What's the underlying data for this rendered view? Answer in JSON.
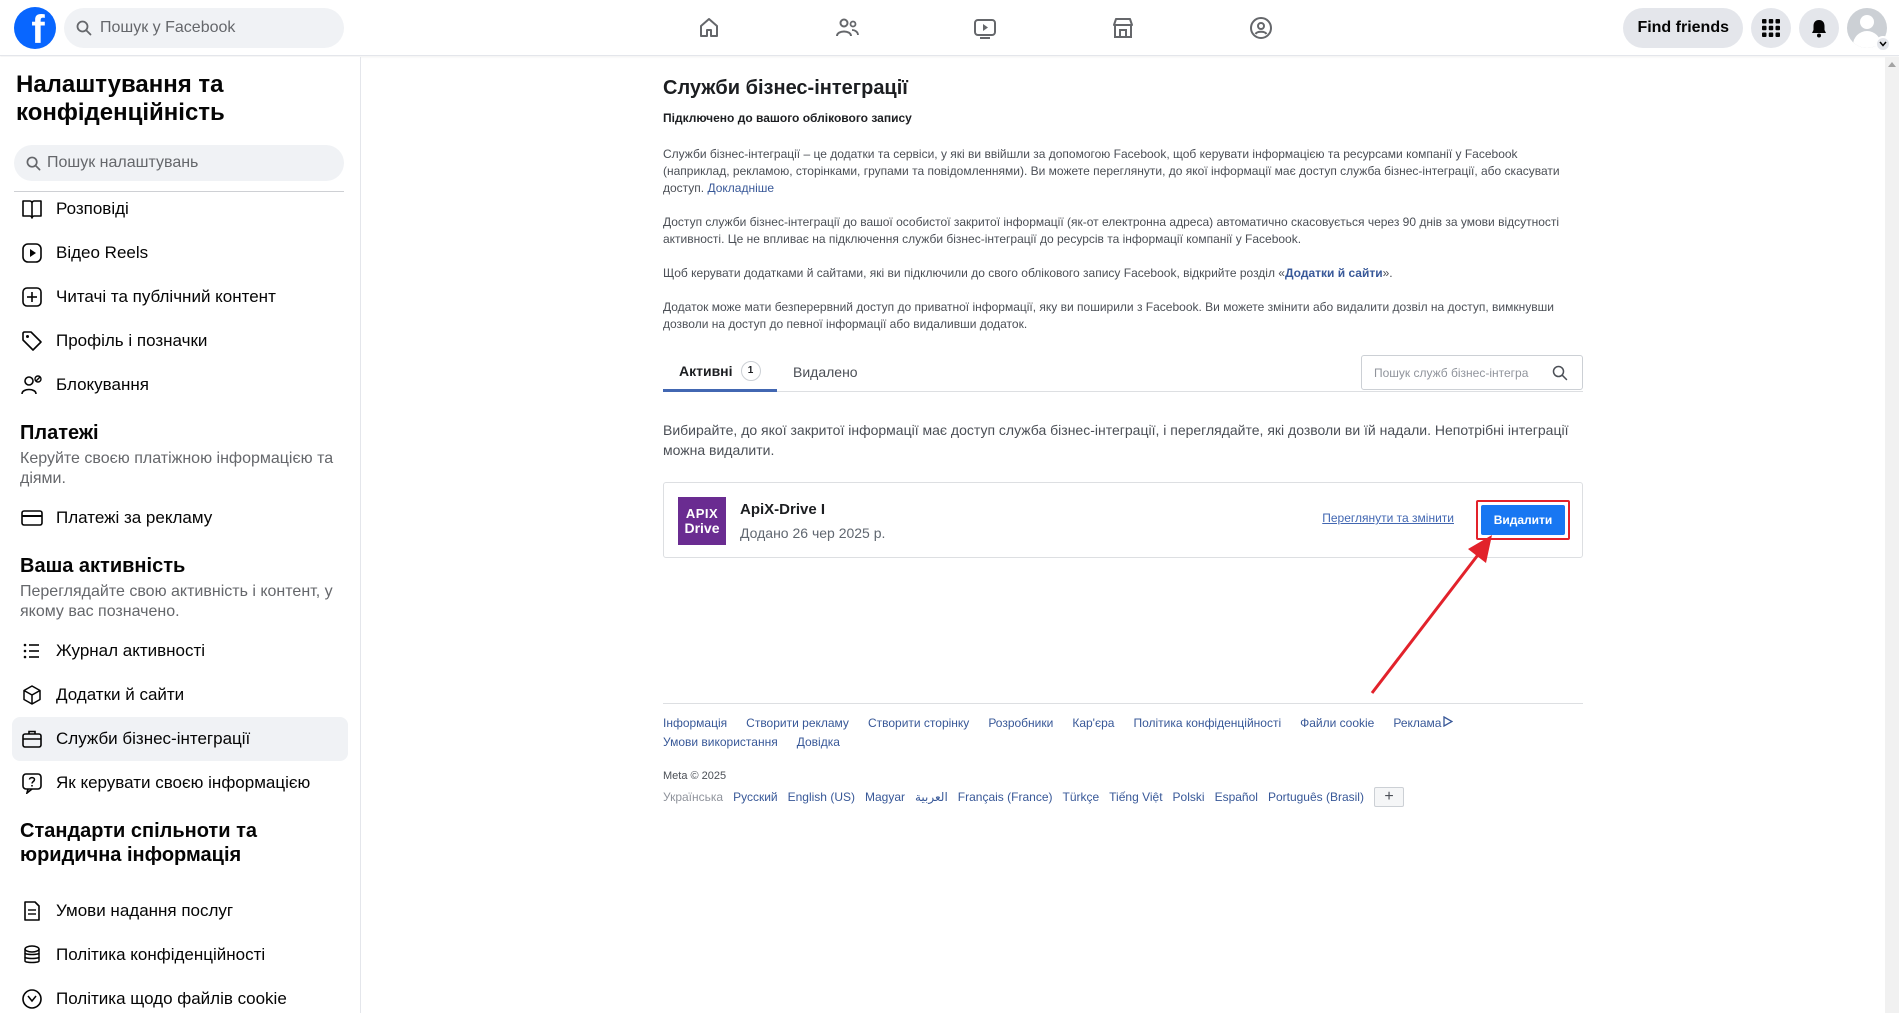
{
  "topbar": {
    "logo_letter": "f",
    "search_placeholder": "Пошук у Facebook",
    "nav": [
      "home-icon",
      "friends-icon",
      "video-icon",
      "marketplace-icon",
      "groups-icon"
    ],
    "find_friends": "Find friends"
  },
  "sidebar": {
    "title": "Налаштування та конфіденційність",
    "search_placeholder": "Пошук налаштувань",
    "items_top": [
      {
        "label": "Розповіді",
        "icon": "book-icon"
      },
      {
        "label": "Відео Reels",
        "icon": "reels-icon"
      },
      {
        "label": "Читачі та публічний контент",
        "icon": "plus-square-icon"
      },
      {
        "label": "Профіль і позначки",
        "icon": "tag-icon"
      },
      {
        "label": "Блокування",
        "icon": "block-user-icon"
      }
    ],
    "payments": {
      "heading": "Платежі",
      "sub": "Керуйте своєю платіжною інформацією та діями.",
      "item": "Платежі за рекламу"
    },
    "activity": {
      "heading": "Ваша активність",
      "sub": "Переглядайте свою активність і контент, у якому вас позначено.",
      "items": [
        {
          "label": "Журнал активності"
        },
        {
          "label": "Додатки й сайти"
        },
        {
          "label": "Служби бізнес-інтеграції"
        },
        {
          "label": "Як керувати своєю інформацією"
        }
      ]
    },
    "standards": {
      "heading": "Стандарти спільноти та юридична інформація",
      "items": [
        {
          "label": "Умови надання послуг"
        },
        {
          "label": "Політика конфіденційності"
        },
        {
          "label": "Політика щодо файлів cookie"
        }
      ]
    }
  },
  "main": {
    "title": "Служби бізнес-інтеграції",
    "subtitle": "Підключено до вашого облікового запису",
    "para1": "Служби бізнес-інтеграції – це додатки та сервіси, у які ви ввійшли за допомогою Facebook, щоб керувати інформацією та ресурсами компанії у Facebook (наприклад, рекламою, сторінками, групами та повідомленнями). Ви можете переглянути, до якої інформації має доступ служба бізнес-інтеграції, або скасувати доступ.",
    "para1_link": "Докладніше",
    "para2": "Доступ служби бізнес-інтеграції до вашої особистої закритої інформації (як-от електронна адреса) автоматично скасовується через 90 днів за умови відсутності активності. Це не впливає на підключення служби бізнес-інтеграції до ресурсів та інформації компанії у Facebook.",
    "para3_a": "Щоб керувати додатками й сайтами, які ви підключили до свого облікового запису Facebook, відкрийте розділ «",
    "para3_link": "Додатки й сайти",
    "para3_b": "».",
    "para4": "Додаток може мати безперервний доступ до приватної інформації, яку ви поширили з Facebook. Ви можете змінити або видалити дозвіл на доступ, вимкнувши дозволи на доступ до певної інформації або видаливши додаток.",
    "tabs": {
      "active": "Активні",
      "active_count": "1",
      "removed": "Видалено"
    },
    "tab_search_placeholder": "Пошук служб бізнес-інтегра",
    "intro": "Вибирайте, до якої закритої інформації має доступ служба бізнес-інтеграції, і переглядайте, які дозволи ви їй надали. Непотрібні інтеграції можна видалити.",
    "app": {
      "logo_line1": "APIX",
      "logo_line2": "Drive",
      "name": "ApiX-Drive I",
      "added": "Додано 26 чер 2025 р.",
      "view_edit": "Переглянути та змінити",
      "delete": "Видалити"
    },
    "footer": {
      "links": [
        "Інформація",
        "Створити рекламу",
        "Створити сторінку",
        "Розробники",
        "Кар'єра",
        "Політика конфіденційності",
        "Файли cookie",
        "Реклама",
        "Умови використання",
        "Довідка"
      ],
      "copyright": "Meta © 2025",
      "current_lang": "Українська",
      "langs": [
        "Русский",
        "English (US)",
        "Magyar",
        "العربية",
        "Français (France)",
        "Türkçe",
        "Tiếng Việt",
        "Polski",
        "Español",
        "Português (Brasil)"
      ],
      "more": "+"
    }
  },
  "colors": {
    "brand": "#0866ff",
    "link": "#385898",
    "button": "#1877f2",
    "highlight": "#e2222b"
  }
}
